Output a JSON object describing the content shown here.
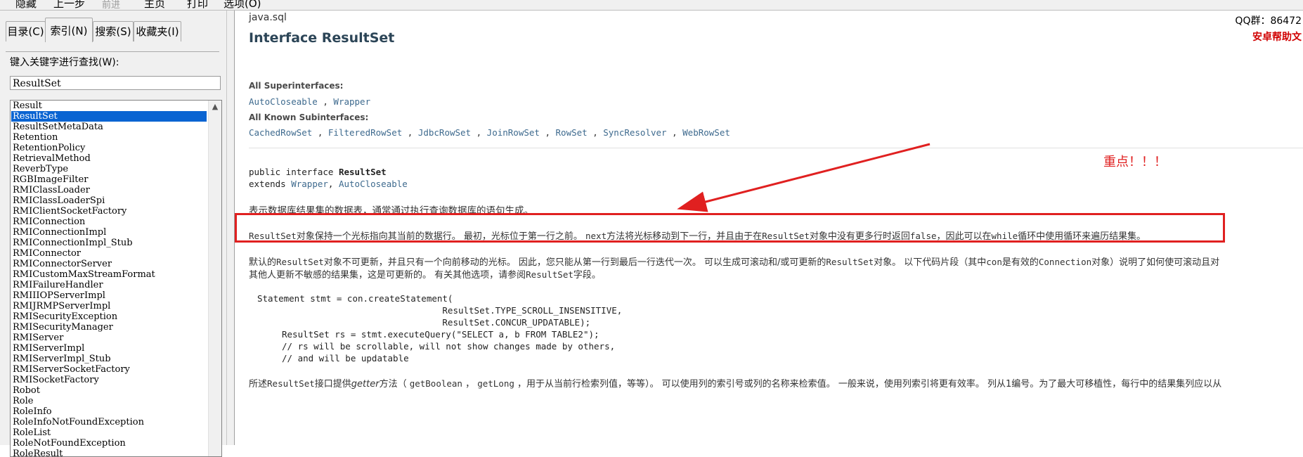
{
  "toolbar": {
    "hide": "隐藏",
    "back": "上一步",
    "forward": "前进",
    "home": "主页",
    "print": "打印",
    "options": "选项(O)"
  },
  "tabs": [
    "目录(C)",
    "索引(N)",
    "搜索(S)",
    "收藏夹(I)"
  ],
  "search": {
    "label": "键入关键字进行查找(W):",
    "value": "ResultSet"
  },
  "index_list": [
    "Result",
    "ResultSet",
    "ResultSetMetaData",
    "Retention",
    "RetentionPolicy",
    "RetrievalMethod",
    "ReverbType",
    "RGBImageFilter",
    "RMIClassLoader",
    "RMIClassLoaderSpi",
    "RMIClientSocketFactory",
    "RMIConnection",
    "RMIConnectionImpl",
    "RMIConnectionImpl_Stub",
    "RMIConnector",
    "RMIConnectorServer",
    "RMICustomMaxStreamFormat",
    "RMIFailureHandler",
    "RMIIIOPServerImpl",
    "RMIJRMPServerImpl",
    "RMISecurityException",
    "RMISecurityManager",
    "RMIServer",
    "RMIServerImpl",
    "RMIServerImpl_Stub",
    "RMIServerSocketFactory",
    "RMISocketFactory",
    "Robot",
    "Role",
    "RoleInfo",
    "RoleInfoNotFoundException",
    "RoleList",
    "RoleNotFoundException",
    "RoleResult"
  ],
  "selected_index": 1,
  "doc": {
    "package": "java.sql",
    "title": "Interface ResultSet",
    "qq": "QQ群：86472",
    "help": "安卓帮助文",
    "superinterfaces_label": "All Superinterfaces:",
    "superinterfaces": [
      "AutoCloseable",
      "Wrapper"
    ],
    "subinterfaces_label": "All Known Subinterfaces:",
    "subinterfaces": [
      "CachedRowSet",
      "FilteredRowSet",
      "JdbcRowSet",
      "JoinRowSet",
      "RowSet",
      "SyncResolver",
      "WebRowSet"
    ],
    "decl_line1_kw": "public interface ",
    "decl_line1_name": "ResultSet",
    "decl_line2_kw": "extends ",
    "decl_line2_a": "Wrapper",
    "decl_line2_sep": ", ",
    "decl_line2_b": "AutoCloseable",
    "desc": "表示数据库结果集的数据表，通常通过执行查询数据库的语句生成。",
    "highlight_1": "ResultSet",
    "highlight_2": "对象保持一个光标指向其当前的数据行。 最初，光标位于第一行之前。 ",
    "highlight_3": "next",
    "highlight_4": "方法将光标移动到下一行，并且由于在",
    "highlight_5": "ResultSet",
    "highlight_6": "对象中没有更多行时返回",
    "highlight_7": "false",
    "highlight_8": "，因此可以在",
    "highlight_9": "while",
    "highlight_10": "循环中使用循环来遍历结果集。",
    "para2_a": "默认的",
    "para2_b": "ResultSet",
    "para2_c": "对象不可更新，并且只有一个向前移动的光标。 因此，您只能从第一行到最后一行迭代一次。 可以生成可滚动和/或可更新的",
    "para2_d": "ResultSet",
    "para2_e": "对象。 以下代码片段（其中",
    "para2_f": "con",
    "para2_g": "是有效的",
    "para2_h": "Connection",
    "para2_i": "对象）说明了如何使可滚动且对",
    "para2_line2_a": "其他人更新不敏感的结果集，这是可更新的。 有关其他选项，请参阅",
    "para2_line2_b": "ResultSet",
    "para2_line2_c": "字段。",
    "code": [
      "Statement stmt = con.createStatement(",
      "                                   ResultSet.TYPE_SCROLL_INSENSITIVE,",
      "                                   ResultSet.CONCUR_UPDATABLE);",
      "ResultSet rs = stmt.executeQuery(\"SELECT a, b FROM TABLE2\");",
      "// rs will be scrollable, will not show changes made by others,",
      "// and will be updatable"
    ],
    "para3_a": "所述",
    "para3_b": "ResultSet",
    "para3_c": "接口提供",
    "para3_d": "getter",
    "para3_e": "方法（ ",
    "para3_f": "getBoolean",
    "para3_g": " ， ",
    "para3_h": "getLong",
    "para3_i": " ，用于从当前行检索列值，等等）。 可以使用列的索引号或列的名称来检索值。 一般来说，使用列索引将更有效率。 列从1编号。为了最大可移植性，每行中的结果集列应以从"
  },
  "annotation": "重点！！！",
  "colors": {
    "annotation": "#e02020",
    "selection": "#0a64d2",
    "link": "#3e6a8e",
    "title": "#2c4557"
  }
}
